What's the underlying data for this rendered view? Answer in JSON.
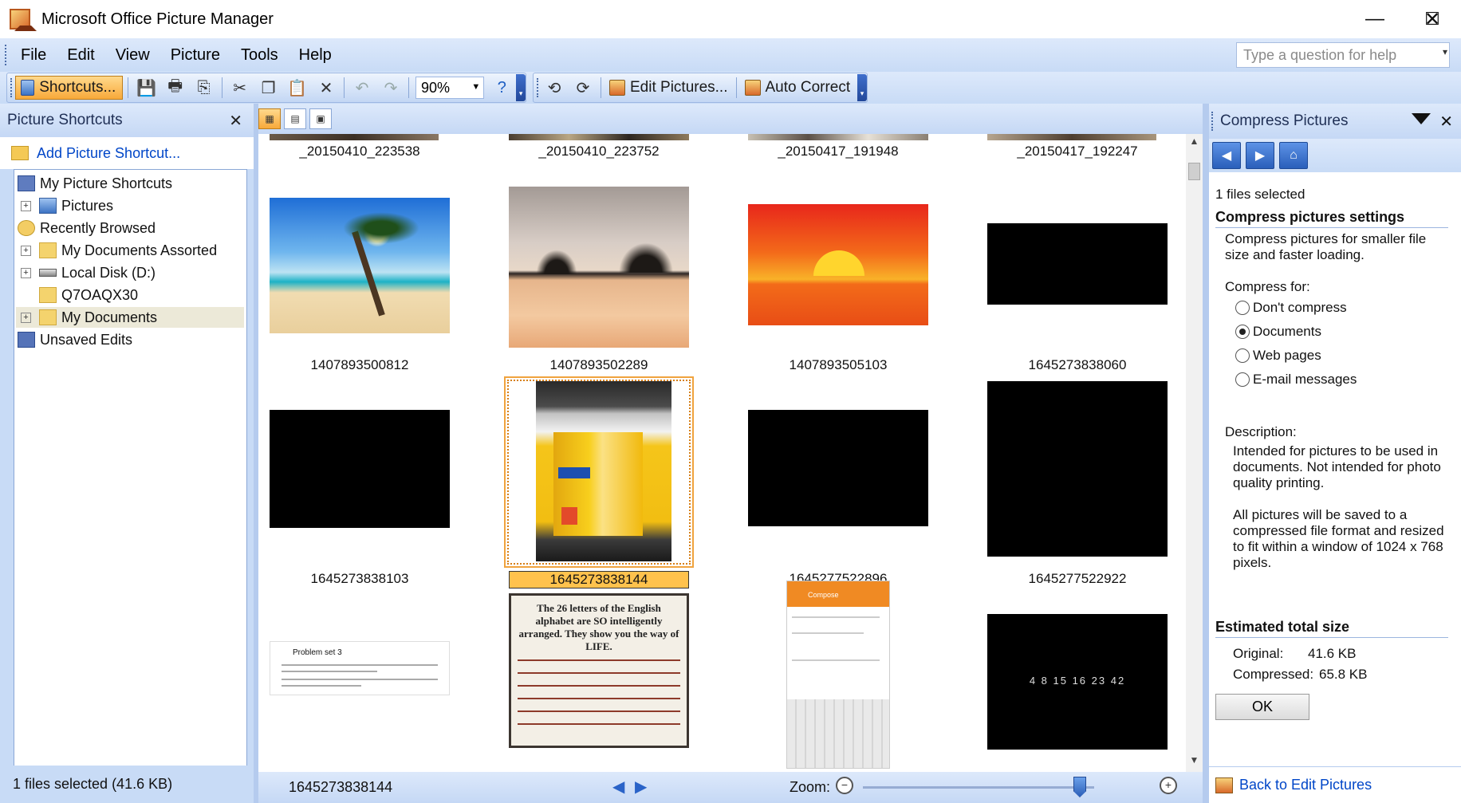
{
  "window": {
    "title": "Microsoft Office Picture Manager",
    "controls": {
      "minimize": "—",
      "maximize": "☐",
      "close": "✕"
    }
  },
  "menubar": {
    "items": [
      "File",
      "Edit",
      "View",
      "Picture",
      "Tools",
      "Help"
    ],
    "help_placeholder": "Type a question for help"
  },
  "toolbar": {
    "shortcuts_label": "Shortcuts...",
    "zoom_value": "90%",
    "edit_pictures_label": "Edit Pictures...",
    "auto_correct_label": "Auto Correct"
  },
  "left_pane": {
    "title": "Picture Shortcuts",
    "add_shortcut": "Add Picture Shortcut...",
    "tree": [
      {
        "label": "My Picture Shortcuts",
        "icon": "shortcuts-icon"
      },
      {
        "label": "Pictures",
        "icon": "pictures-icon"
      },
      {
        "label": "Recently Browsed",
        "icon": "recent-icon"
      },
      {
        "label": "My Documents Assorted",
        "icon": "folder-icon"
      },
      {
        "label": "Local Disk (D:)",
        "icon": "disk-icon"
      },
      {
        "label": "Q7OAQX30",
        "icon": "folder-icon"
      },
      {
        "label": "My Documents",
        "icon": "folder-icon"
      },
      {
        "label": "Unsaved Edits",
        "icon": "unsaved-icon"
      }
    ],
    "status": "1 files selected (41.6 KB)"
  },
  "thumbnails": [
    {
      "name": "_20150410_223538"
    },
    {
      "name": "_20150410_223752"
    },
    {
      "name": "_20150417_191948"
    },
    {
      "name": "_20150417_192247"
    },
    {
      "name": "1407893500812"
    },
    {
      "name": "1407893502289"
    },
    {
      "name": "1407893505103"
    },
    {
      "name": "1645273838060"
    },
    {
      "name": "1645273838103"
    },
    {
      "name": "1645273838144",
      "selected": true
    },
    {
      "name": "1645277522896"
    },
    {
      "name": "1645277522922"
    },
    {
      "name": "Problem set 3"
    },
    {
      "name": "The 26 letters of the English alphabet are SO intelligently arranged. They show you the way of LIFE."
    },
    {
      "name": "Compose"
    },
    {
      "name": "4 8 15 16 23 42"
    }
  ],
  "center_status": {
    "filename": "1645273838144",
    "zoom_label": "Zoom:"
  },
  "right_pane": {
    "title": "Compress Pictures",
    "selection": "1 files selected",
    "settings_heading": "Compress pictures settings",
    "settings_desc": "Compress pictures for smaller file size and faster loading.",
    "compress_for_label": "Compress for:",
    "options": [
      "Don't compress",
      "Documents",
      "Web pages",
      "E-mail messages"
    ],
    "selected_option": "Documents",
    "description_label": "Description:",
    "description_1": "Intended for pictures to be used in documents. Not intended for photo quality printing.",
    "description_2": "All pictures will be saved to a compressed file format and resized to fit within a window of 1024 x 768 pixels.",
    "estimated_heading": "Estimated total size",
    "original_label": "Original:",
    "original_value": "41.6 KB",
    "compressed_label": "Compressed:",
    "compressed_value": "65.8 KB",
    "ok_label": "OK",
    "back_link": "Back to Edit Pictures"
  }
}
